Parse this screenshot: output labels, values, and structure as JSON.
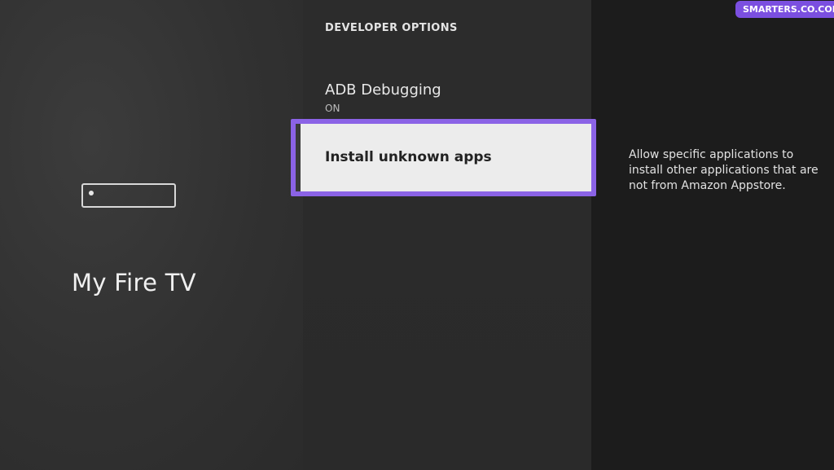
{
  "left_panel": {
    "title": "My Fire TV",
    "device_icon": "fire-tv-device-icon"
  },
  "middle_panel": {
    "breadcrumb": "DEVELOPER OPTIONS",
    "items": [
      {
        "label": "ADB Debugging",
        "value": "ON"
      },
      {
        "label": "Install unknown apps"
      }
    ]
  },
  "right_panel": {
    "description": "Allow specific applications to install other applications that are not from Amazon Appstore."
  },
  "watermark": {
    "text": "SMARTERS.CO.COM"
  },
  "colors": {
    "focus_border": "#8b63e6",
    "watermark_bg": "#7b4fe0"
  }
}
